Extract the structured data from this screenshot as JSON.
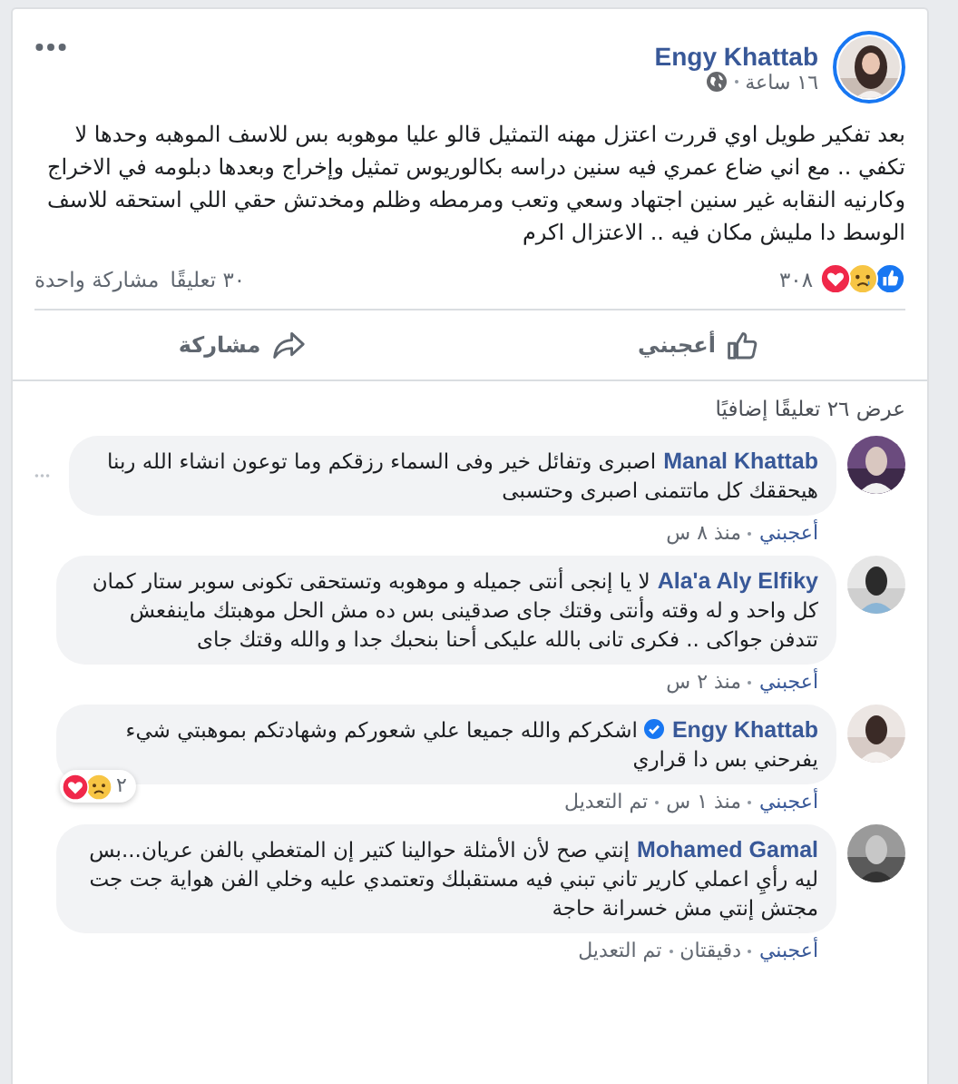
{
  "post": {
    "author": "Engy Khattab",
    "time": "١٦ ساعة",
    "text": "بعد تفكير طويل اوي قررت اعتزل مهنه التمثيل قالو عليا موهوبه بس للاسف الموهبه وحدها لا تكفي .. مع اني ضاع عمري فيه سنين دراسه بكالوريوس تمثيل وإخراج وبعدها دبلومه في الاخراج وكارنيه النقابه غير سنين اجتهاد وسعي وتعب ومرمطه وظلم ومخدتش حقي اللي استحقه للاسف الوسط دا مليش مكان فيه .. الاعتزال اكرم",
    "reaction_count": "٣٠٨",
    "comments_count": "٣٠ تعليقًا",
    "shares_count": "مشاركة واحدة"
  },
  "actions": [
    {
      "kind": "like",
      "label": "أعجبني"
    },
    {
      "kind": "share",
      "label": "مشاركة"
    }
  ],
  "more_comments": "عرض ٢٦ تعليقًا إضافيًا",
  "comments": [
    {
      "author": "Manal Khattab",
      "verified": false,
      "text": "اصبرى وتفائل خير وفى السماء رزقكم وما توعون انشاء الله ربنا هيحققك كل ماتتمنى اصبرى وحتسبى",
      "like": "أعجبني",
      "time": "منذ ٨ س",
      "menu": true
    },
    {
      "author": "Ala'a Aly Elfiky",
      "verified": false,
      "text": "لا يا إنجى أنتى جميله و موهوبه وتستحقى تكونى سوبر ستار كمان كل واحد و له وقته وأنتى وقتك جاى صدقينى بس ده مش الحل موهبتك ماينفعش تتدفن جواكى .. فكرى تانى بالله عليكى أحنا بنحبك جدا و والله وقتك جاى",
      "like": "أعجبني",
      "time": "منذ ٢ س",
      "menu": false
    },
    {
      "author": "Engy Khattab",
      "verified": true,
      "text": "اشكركم والله جميعا علي شعوركم وشهادتكم بموهبتي شيء يفرحني بس دا قراري",
      "like": "أعجبني",
      "time": "منذ ١ س",
      "edited": "تم التعديل",
      "reaction_count": "٢",
      "menu": false
    },
    {
      "author": "Mohamed Gamal",
      "verified": false,
      "text": "إنتي صح لأن الأمثلة حوالينا كتير إن المتغطي بالفن عريان...بس ليه رأيِ اعملي كارير تاني تبني فيه مستقبلك وتعتمدي عليه وخلي الفن هواية جت جت مجتش إنتي مش خسرانة حاجة",
      "like": "أعجبني",
      "time": "دقيقتان",
      "edited": "تم التعديل",
      "menu": false
    }
  ]
}
